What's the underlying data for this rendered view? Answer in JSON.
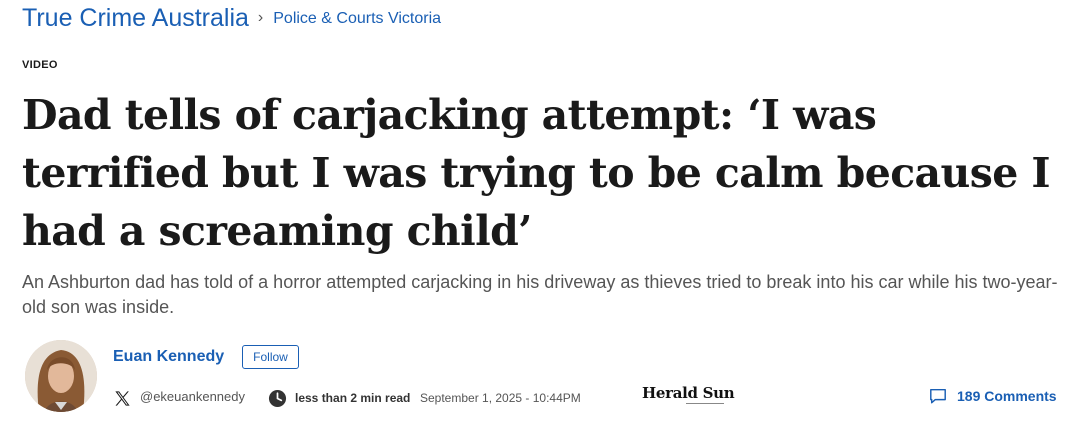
{
  "breadcrumb": {
    "home": "True Crime Australia",
    "separator": "›",
    "section": "Police & Courts Victoria"
  },
  "article": {
    "label": "VIDEO",
    "headline": "Dad tells of carjacking attempt: ‘I was terrified but I was trying to be calm because I had a screaming child’",
    "standfirst": "An Ashburton dad has told of a horror attempted carjacking in his driveway as thieves tried to break into his car while his two-year-old son was inside."
  },
  "author": {
    "name": "Euan Kennedy",
    "follow_label": "Follow",
    "social_icon": "x-logo-icon",
    "handle": "@ekeuankennedy"
  },
  "meta": {
    "clock_icon": "clock-icon",
    "read_time": "less than 2 min read",
    "published": "September 1, 2025 - 10:44PM"
  },
  "masthead": {
    "name": "Herald Sun"
  },
  "comments": {
    "icon": "comment-icon",
    "label": "189 Comments"
  },
  "colors": {
    "link": "#1a5fb4",
    "text": "#1a1a1a",
    "muted": "#555555"
  }
}
